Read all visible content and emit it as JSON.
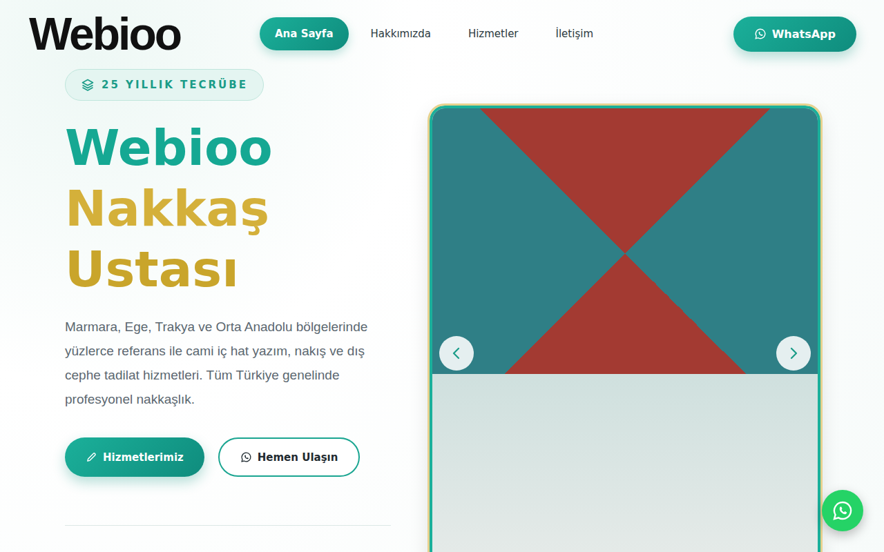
{
  "header": {
    "logo": "Webioo",
    "nav": [
      {
        "label": "Ana Sayfa",
        "selected": true
      },
      {
        "label": "Hakkımızda",
        "selected": false
      },
      {
        "label": "Hizmetler",
        "selected": false
      },
      {
        "label": "İletişim",
        "selected": false
      }
    ],
    "cta": "WhatsApp"
  },
  "hero": {
    "badge": "25 YILLIK TECRÜBE",
    "title": [
      {
        "text": "Webioo",
        "color": "#15a893"
      },
      {
        "text": "Nakkaş",
        "color": "#d4b03a"
      },
      {
        "text": "Ustası",
        "color": "#c9a52b"
      }
    ],
    "description": "Marmara, Ege, Trakya ve Orta Anadolu bölgelerinde yüzlerce referans ile cami iç hat yazım, nakış ve dış cephe tadilat hizmetleri. Tüm Türkiye genelinde profesyonel nakkaşlık.",
    "buttons": [
      {
        "label": "Hizmetlerimiz",
        "kind": "primary"
      },
      {
        "label": "Hemen Ulaşın",
        "kind": "outline"
      }
    ]
  }
}
